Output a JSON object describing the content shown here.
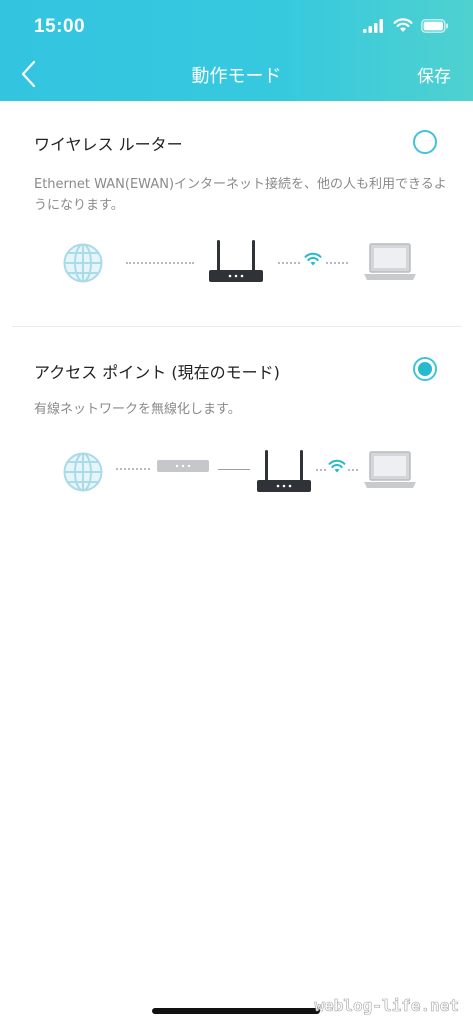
{
  "status_bar": {
    "time": "15:00"
  },
  "nav": {
    "title": "動作モード",
    "save_label": "保存"
  },
  "options": [
    {
      "title": "ワイヤレス ルーター",
      "description": "Ethernet WAN(EWAN)インターネット接続を、他の人も利用できるようになります。",
      "selected": false
    },
    {
      "title": "アクセス ポイント (現在のモード)",
      "description": "有線ネットワークを無線化します。",
      "selected": true
    }
  ],
  "watermark": "weblog-life.net",
  "colors": {
    "accent": "#27b9cf",
    "header_start": "#33c4e0",
    "header_end": "#4fd1cf"
  },
  "icons": [
    "globe-icon",
    "router-icon",
    "wifi-icon",
    "laptop-icon",
    "modem-icon"
  ]
}
